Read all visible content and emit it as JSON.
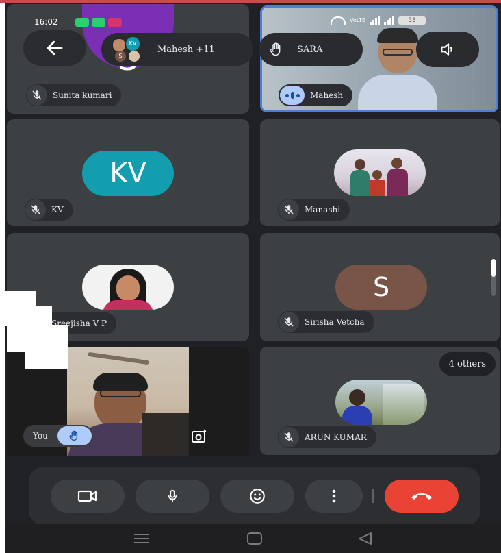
{
  "status": {
    "time": "16:02",
    "network": "VoLTE",
    "battery": "53"
  },
  "header": {
    "presenters_label": "Mahesh +11",
    "hand_label": "SARA",
    "avatar_initials": [
      "KV",
      "S"
    ]
  },
  "tiles": [
    {
      "name": "Sunita kumari",
      "kind": "avatar-letter",
      "letter": "S",
      "color": "#7b2fb5"
    },
    {
      "name": "Mahesh",
      "kind": "video",
      "speaking": true
    },
    {
      "name": "KV",
      "kind": "avatar-letter",
      "letter": "KV",
      "color": "#129eaf"
    },
    {
      "name": "Manashi",
      "kind": "photo"
    },
    {
      "name": "Sreejisha V P",
      "kind": "photo"
    },
    {
      "name": "Sirisha Vetcha",
      "kind": "avatar-letter",
      "letter": "S",
      "color": "#795548"
    },
    {
      "name": "You",
      "kind": "self-video",
      "hand_raised": true
    },
    {
      "name": "ARUN KUMAR",
      "kind": "photo",
      "others_label": "4 others"
    }
  ],
  "colors": {
    "background": "#202124",
    "tile": "#3c4043",
    "end_call": "#ea4335",
    "accent": "#8ab4f8"
  },
  "controls": [
    "camera-icon",
    "mic-icon",
    "emoji-icon",
    "more-icon",
    "end-call-icon"
  ],
  "nav": [
    "menu-icon",
    "home-icon",
    "back-icon"
  ]
}
